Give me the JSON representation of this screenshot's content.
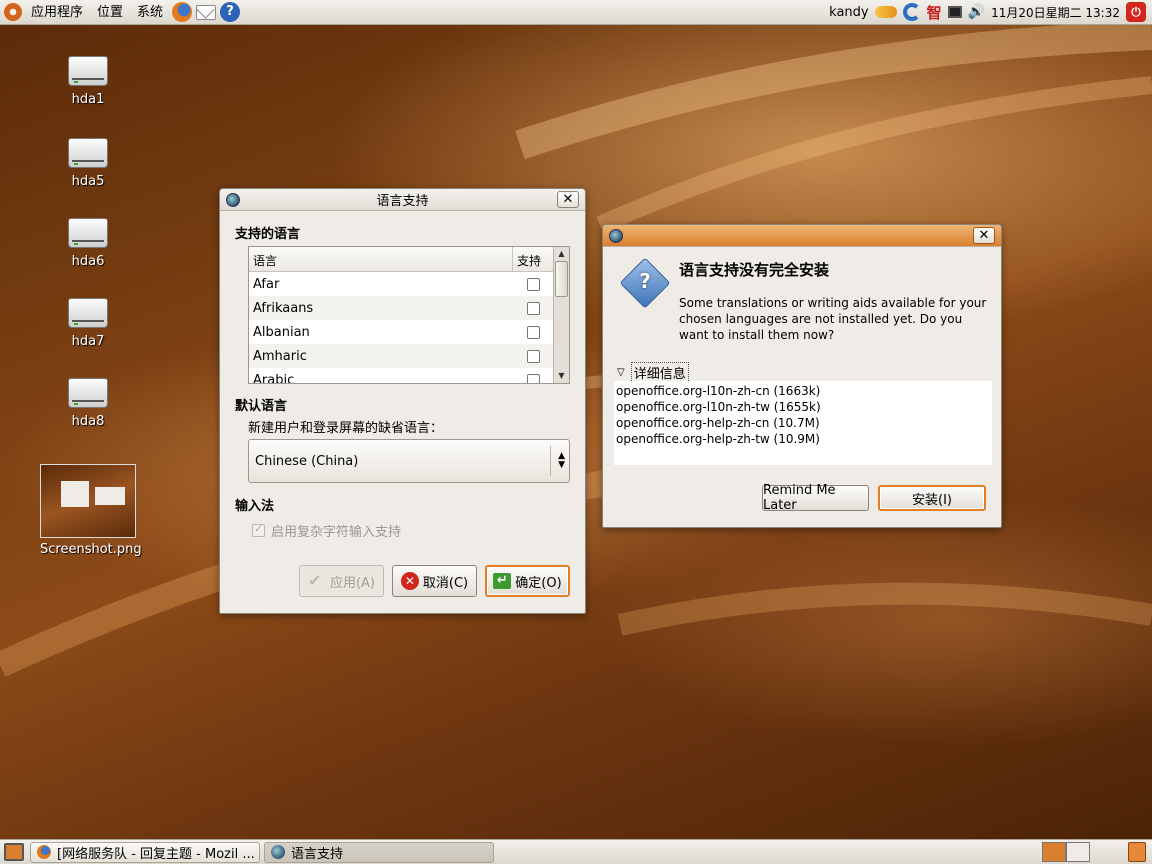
{
  "top_panel": {
    "menus": [
      "应用程序",
      "位置",
      "系统"
    ],
    "user": "kandy",
    "ime_label": "智",
    "clock": "11月20日星期二 13:32"
  },
  "desktop": {
    "icons": [
      "hda1",
      "hda5",
      "hda6",
      "hda7",
      "hda8",
      "Screenshot.png"
    ]
  },
  "lang_window": {
    "title": "语言支持",
    "supported_title": "支持的语言",
    "col_language": "语言",
    "col_support": "支持",
    "languages": [
      "Afar",
      "Afrikaans",
      "Albanian",
      "Amharic",
      "Arabic"
    ],
    "default_title": "默认语言",
    "default_desc": "新建用户和登录屏幕的缺省语言：",
    "default_value": "Chinese (China)",
    "input_title": "输入法",
    "complex_input": "启用复杂字符输入支持",
    "apply": "应用(A)",
    "cancel": "取消(C)",
    "ok": "确定(O)"
  },
  "dialog": {
    "heading": "语言支持没有完全安装",
    "body": "Some translations or writing aids available for your chosen languages are not installed yet. Do you want to install them now?",
    "details_label": "详细信息",
    "details": [
      "openoffice.org-l10n-zh-cn (1663k)",
      "openoffice.org-l10n-zh-tw (1655k)",
      "openoffice.org-help-zh-cn (10.7M)",
      "openoffice.org-help-zh-tw (10.9M)"
    ],
    "remind": "Remind Me Later",
    "install": "安装(I)"
  },
  "taskbar": {
    "tasks": [
      "[网络服务队 - 回复主题 - Mozil ...",
      "语言支持"
    ]
  }
}
